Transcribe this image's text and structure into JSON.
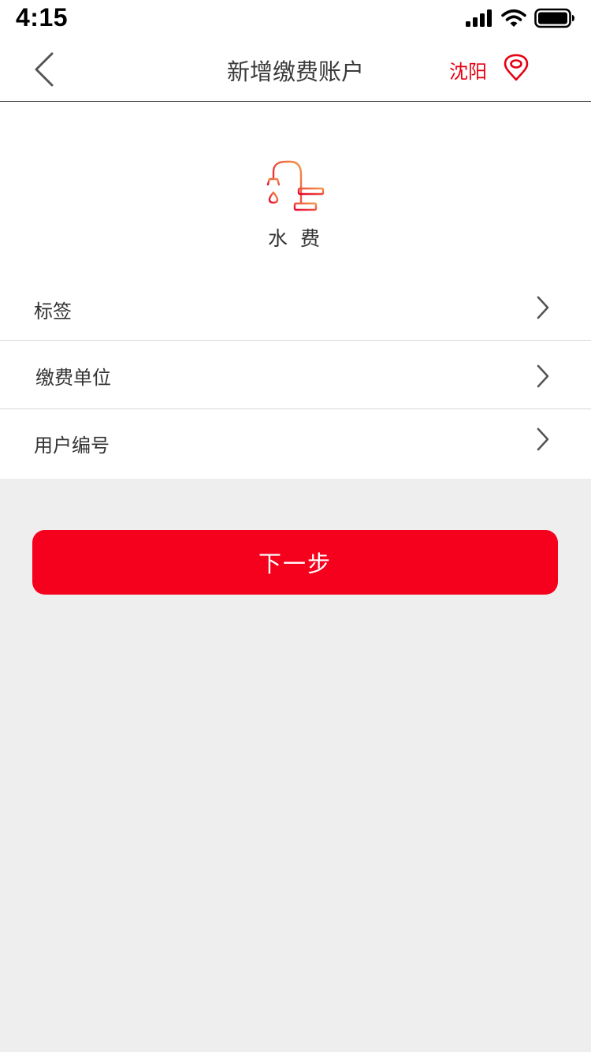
{
  "status_bar": {
    "time": "4:15",
    "icons": [
      "cellular-signal-icon",
      "wifi-icon",
      "battery-icon"
    ]
  },
  "nav": {
    "back_icon": "chevron-left-icon",
    "title": "新增缴费账户",
    "city": "沈阳",
    "location_icon": "map-pin-icon"
  },
  "service": {
    "icon": "water-faucet-icon",
    "name": "水 费"
  },
  "form": {
    "rows": [
      {
        "label": "标签",
        "icon": "chevron-right-icon"
      },
      {
        "label": "缴费单位",
        "icon": "chevron-right-icon"
      },
      {
        "label": "用户编号",
        "icon": "chevron-right-icon"
      }
    ]
  },
  "actions": {
    "next_label": "下一步"
  },
  "colors": {
    "accent_red": "#e60012",
    "button_red": "#f5001d",
    "background_gray": "#eeeeee",
    "text_dark": "#333333"
  }
}
